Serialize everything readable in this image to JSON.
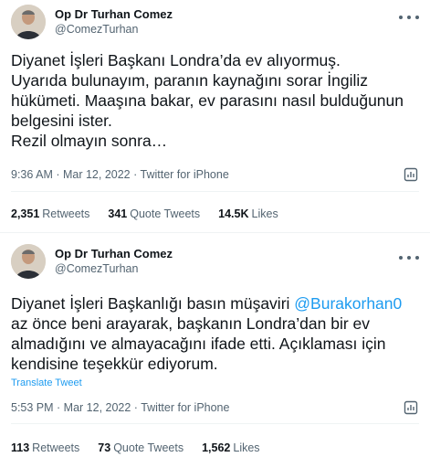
{
  "tweets": [
    {
      "author": {
        "display_name": "Op Dr Turhan Comez",
        "handle": "@ComezTurhan"
      },
      "text": "Diyanet İşleri Başkanı Londra’da ev alıyormuş.\nUyarıda bulunayım, paranın kaynağını sorar İngiliz hükümeti. Maaşına bakar, ev parasını nasıl bulduğunun belgesini ister.\nRezil olmayın sonra…",
      "meta": "9:36 AM · Mar 12, 2022 · Twitter for iPhone",
      "stats": {
        "retweets_count": "2,351",
        "retweets_label": "Retweets",
        "quotes_count": "341",
        "quotes_label": "Quote Tweets",
        "likes_count": "14.5K",
        "likes_label": "Likes"
      }
    },
    {
      "author": {
        "display_name": "Op Dr Turhan Comez",
        "handle": "@ComezTurhan"
      },
      "text_before": "Diyanet İşleri Başkanlığı basın müşaviri ",
      "mention": "@Burakorhan0",
      "text_after": "\naz önce beni arayarak, başkanın Londra’dan bir ev almadığını ve almayacağını ifade etti. Açıklaması için kendisine teşekkür ediyorum.",
      "translate_label": "Translate Tweet",
      "meta": "5:53 PM · Mar 12, 2022 · Twitter for iPhone",
      "stats": {
        "retweets_count": "113",
        "retweets_label": "Retweets",
        "quotes_count": "73",
        "quotes_label": "Quote Tweets",
        "likes_count": "1,562",
        "likes_label": "Likes"
      }
    }
  ],
  "icons": {
    "avatar": "profile-photo",
    "menu": "more-dots-icon",
    "analytics": "analytics-icon"
  },
  "colors": {
    "link": "#1d9bf0",
    "secondary_text": "#536471",
    "primary_text": "#0f1419",
    "divider": "#eff3f4"
  }
}
